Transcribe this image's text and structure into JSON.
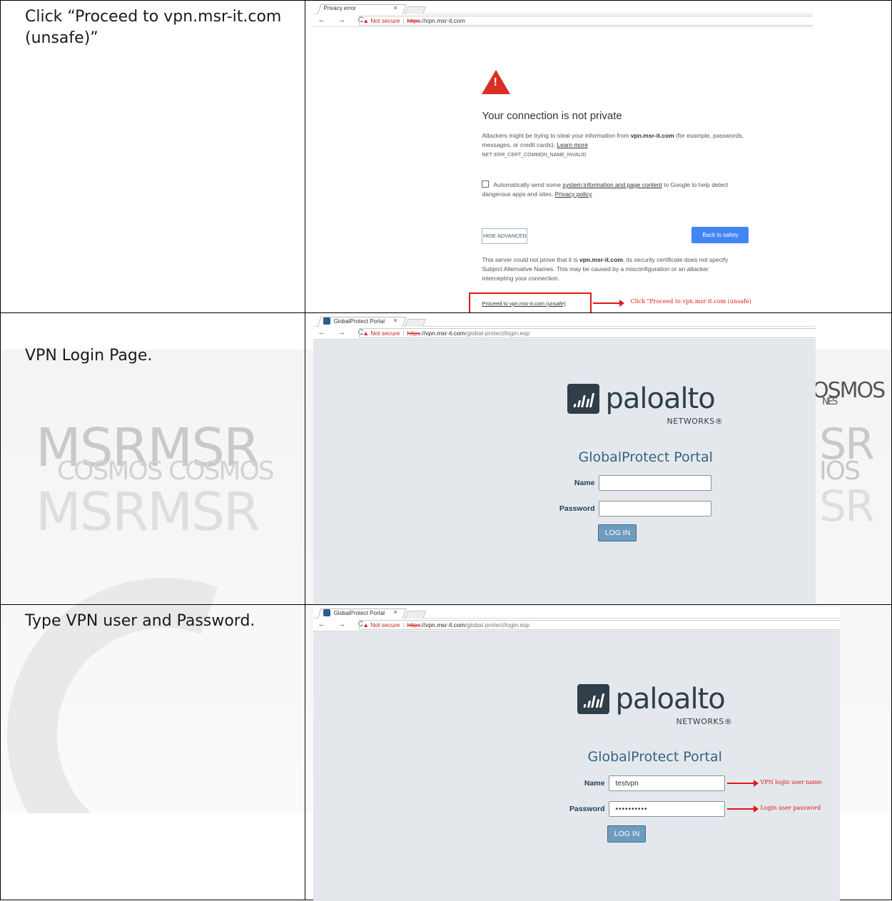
{
  "watermark": {
    "msr1": "MSRMSR",
    "cosmos1": "COSMOS COSMOS",
    "msr2": "MSRMSR",
    "right_top": "OSMOS",
    "right_sub": "NES",
    "right_r1": "SR",
    "right_os": "IOS",
    "right_r2": "SR"
  },
  "rows": [
    {
      "instruction": "Click “Proceed to vpn.msr-it.com (unsafe)”"
    },
    {
      "instruction": "VPN Login Page."
    },
    {
      "instruction": "Type VPN user and Password."
    }
  ],
  "browser1": {
    "tab_title": "Privacy error",
    "tab_close": "×",
    "nav": "← → C",
    "not_secure": "Not secure",
    "https": "https",
    "url_rest": "://vpn.msr-it.com",
    "heading": "Your connection is not private",
    "body_prefix": "Attackers might be trying to steal your information from ",
    "body_domain": "vpn.msr-it.com",
    "body_suffix": " (for example, passwords, messages, or credit cards). ",
    "learn_more": "Learn more",
    "error_code": "NET::ERR_CERT_COMMON_NAME_INVALID",
    "auto_send_prefix": "Automatically send some ",
    "auto_send_link": "system information and page content",
    "auto_send_suffix": " to Google to help detect dangerous apps and sites. ",
    "privacy_policy": "Privacy policy",
    "hide_advanced": "HIDE ADVANCED",
    "back_to_safety": "Back to safety",
    "adv_prefix": "This server could not prove that it is ",
    "adv_domain": "vpn.msr-it.com",
    "adv_suffix": "; its security certificate does not specify Subject Alternative Names. This may be caused by a misconfiguration or an attacker intercepting your connection.",
    "proceed_link": "Proceed to vpn.msr-it.com (unsafe)",
    "annotation": "Click \"Proceed to vpn.msr-it.com (unsafe)"
  },
  "browser2": {
    "tab_title": "GlobalProtect Portal",
    "tab_close": "×",
    "nav": "← → C",
    "not_secure": "Not secure",
    "https": "https",
    "url_domain": "://vpn.msr-it.com",
    "url_path": "/global-protect/login.esp",
    "logo_word": "paloalto",
    "logo_sub": "NETWORKS®",
    "portal_title": "GlobalProtect Portal",
    "name_label": "Name",
    "password_label": "Password",
    "name_value": "",
    "password_value": "",
    "login_button": "LOG IN"
  },
  "browser3": {
    "tab_title": "GlobalProtect Portal",
    "tab_close": "×",
    "nav": "← → C",
    "not_secure": "Not secure",
    "https": "https",
    "url_domain": "://vpn.msr-it.com",
    "url_path": "/global-protect/login.esp",
    "logo_word": "paloalto",
    "logo_sub": "NETWORKS®",
    "portal_title": "GlobalProtect Portal",
    "name_label": "Name",
    "password_label": "Password",
    "name_value": "testvpn",
    "password_value": "••••••••••",
    "login_button": "LOG IN",
    "annotation_user": "VPN login user name",
    "annotation_pass": "Login user password"
  }
}
